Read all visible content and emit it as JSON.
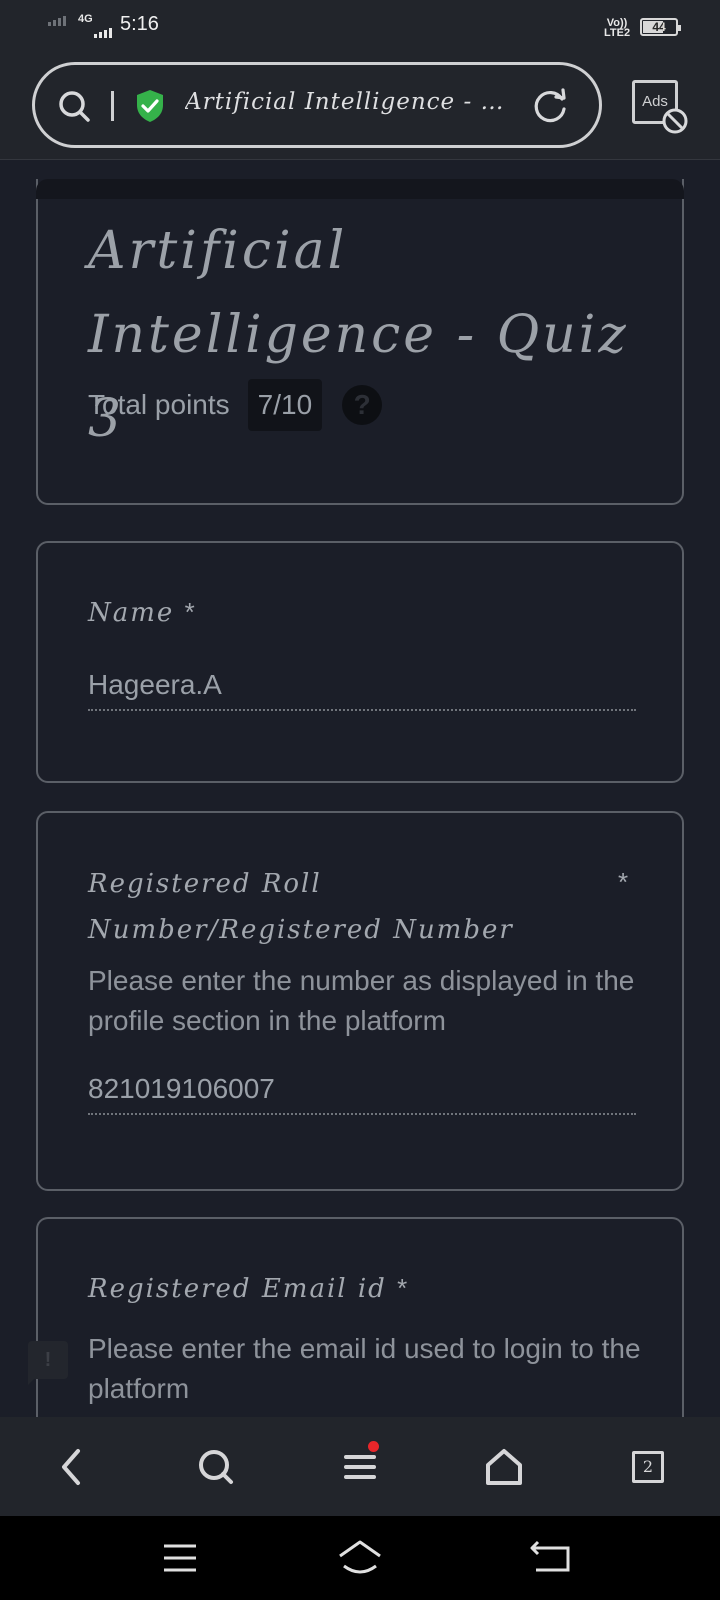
{
  "status_bar": {
    "network_type": "4G",
    "time": "5:16",
    "volte_label_top": "Vo))",
    "volte_label_bottom": "LTE2",
    "battery": "44"
  },
  "browser": {
    "tab_title": "Artificial Intelligence - Q...",
    "ads_label": "Ads",
    "tab_count": "2"
  },
  "quiz": {
    "title": "Artificial Intelligence - Quiz 3",
    "points_label": "Total points",
    "points_value": "7/10",
    "help_symbol": "?"
  },
  "fields": {
    "name": {
      "label": "Name",
      "required": "*",
      "value": "Hageera.A"
    },
    "roll": {
      "label": "Registered Roll Number/Registered Number",
      "required": "*",
      "description": "Please enter the number as displayed in the profile section in the platform",
      "value": "821019106007"
    },
    "email": {
      "label": "Registered Email id",
      "required": "*",
      "description": "Please enter the email id used to login to the platform"
    }
  },
  "feedback_symbol": "!",
  "colors": {
    "background": "#1b1e28",
    "secure_shield": "#35b24a",
    "notification_dot": "#e8262a"
  }
}
